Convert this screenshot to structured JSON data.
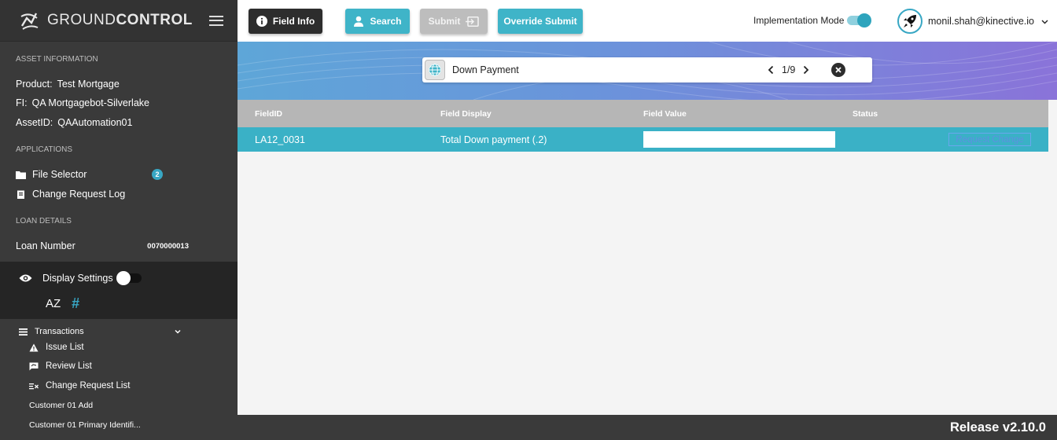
{
  "app": {
    "logo_prefix": "GROUND",
    "logo_suffix": "CONTROL"
  },
  "sidebar": {
    "asset_heading": "ASSET INFORMATION",
    "product_label": "Product:",
    "product_value": "Test Mortgage",
    "fi_label": "FI:",
    "fi_value": "QA Mortgagebot-Silverlake",
    "asset_label": "AssetID:",
    "asset_value": "QAAutomation01",
    "applications_heading": "APPLICATIONS",
    "apps": [
      {
        "label": "File Selector",
        "badge": "2"
      },
      {
        "label": "Change Request Log"
      }
    ],
    "loan_heading": "LOAN DETAILS",
    "loan_number_label": "Loan Number",
    "loan_number_value": "0070000013",
    "display_settings_label": "Display Settings",
    "sort_az": "AZ",
    "sort_hash": "#",
    "transactions_label": "Transactions",
    "transaction_items": [
      "Issue List",
      "Review List",
      "Change Request List",
      "Customer 01 Add",
      "Customer 01 Primary Identifi..."
    ]
  },
  "toolbar": {
    "field_info": "Field Info",
    "search": "Search",
    "submit": "Submit",
    "override_submit": "Override Submit",
    "implementation_mode": "Implementation Mode",
    "user_email": "monil.shah@kinective.io"
  },
  "search": {
    "value": "Down Payment",
    "count": "1/9"
  },
  "table": {
    "headers": [
      "FieldID",
      "Field Display",
      "Field Value",
      "Status"
    ],
    "rows": [
      {
        "field_id": "LA12_0031",
        "field_display": "Total Down payment (.2)",
        "field_value": "",
        "action": "Request Change"
      }
    ]
  },
  "footer": {
    "release": "Release v2.10.0"
  },
  "colors": {
    "accent": "#3ab1c6",
    "sidebar_bg": "#3a3a3a",
    "header_dark": "#2d2d2d"
  }
}
